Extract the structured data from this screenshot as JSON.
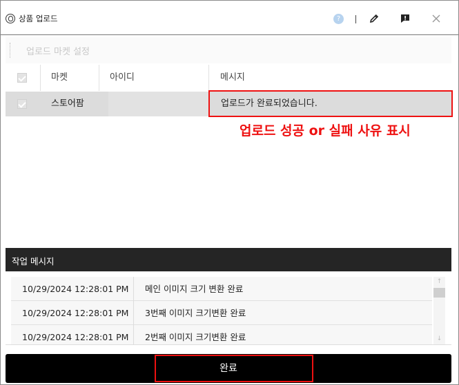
{
  "window": {
    "title": "상품 업로드",
    "help_glyph": "?",
    "icons": [
      "app-logo-icon",
      "help-icon",
      "pencil-icon",
      "report-icon",
      "close-icon"
    ]
  },
  "settings": {
    "label": "업로드 마켓 설정"
  },
  "grid": {
    "columns": [
      "마켓",
      "아이디",
      "메시지"
    ],
    "rows": [
      {
        "market": "스토어팜",
        "id": "",
        "message": "업로드가 완료되었습니다."
      }
    ]
  },
  "annotation": {
    "text": "업로드 성공 or 실패 사유 표시",
    "color": "#ee1111"
  },
  "log": {
    "title": "작업 메시지",
    "rows": [
      {
        "time": "10/29/2024 12:28:01 PM",
        "message": "메인 이미지 크기 변환 완료"
      },
      {
        "time": "10/29/2024 12:28:01 PM",
        "message": "3번째 이미지 크기변환 완료"
      },
      {
        "time": "10/29/2024 12:28:01 PM",
        "message": "2번째 이미지 크기변환 완료"
      }
    ],
    "scroll_up_glyph": "↑",
    "scroll_down_glyph": "↓"
  },
  "footer": {
    "done_label": "완료"
  }
}
